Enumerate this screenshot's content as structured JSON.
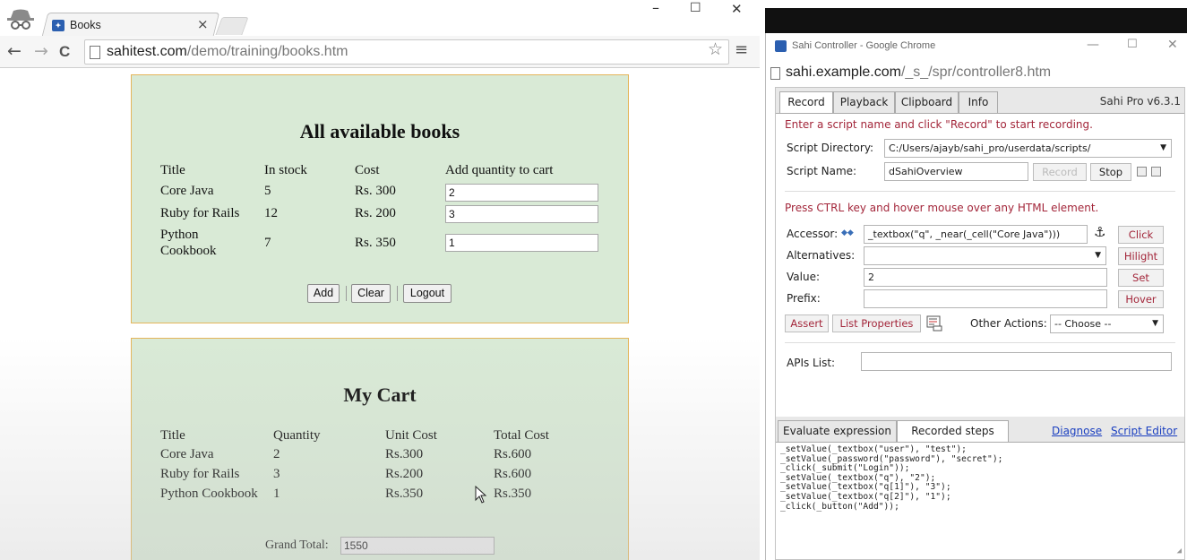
{
  "left_browser": {
    "tab": {
      "title": "Books",
      "close": "×"
    },
    "window_controls": {
      "minimize": "–",
      "maximize": "☐",
      "close": "✕"
    },
    "nav": {
      "back": "←",
      "forward": "→",
      "reload": "C"
    },
    "url": {
      "host": "sahitest.com",
      "path": "/demo/training/books.htm"
    },
    "star": "☆",
    "menu": "≡"
  },
  "books": {
    "title": "All available books",
    "headers": [
      "Title",
      "In stock",
      "Cost",
      "Add quantity to cart"
    ],
    "rows": [
      {
        "title": "Core Java",
        "stock": "5",
        "cost": "Rs. 300",
        "qty": "2"
      },
      {
        "title": "Ruby for Rails",
        "stock": "12",
        "cost": "Rs. 200",
        "qty": "3"
      },
      {
        "title_line1": "Python",
        "title_line2": "Cookbook",
        "stock": "7",
        "cost": "Rs. 350",
        "qty": "1"
      }
    ],
    "buttons": {
      "add": "Add",
      "clear": "Clear",
      "logout": "Logout"
    }
  },
  "cart": {
    "title": "My Cart",
    "headers": [
      "Title",
      "Quantity",
      "Unit Cost",
      "Total Cost"
    ],
    "rows": [
      {
        "title": "Core Java",
        "qty": "2",
        "unit": "Rs.300",
        "total": "Rs.600"
      },
      {
        "title": "Ruby for Rails",
        "qty": "3",
        "unit": "Rs.200",
        "total": "Rs.600"
      },
      {
        "title": "Python Cookbook",
        "qty": "1",
        "unit": "Rs.350",
        "total": "Rs.350"
      }
    ],
    "grand_total_label": "Grand Total:",
    "grand_total": "1550"
  },
  "controller": {
    "window_title": "Sahi Controller - Google Chrome",
    "window_controls": {
      "minimize": "—",
      "maximize": "☐",
      "close": "✕"
    },
    "url": {
      "host": "sahi.example.com",
      "path": "/_s_/spr/controller8.htm"
    },
    "tabs": [
      "Record",
      "Playback",
      "Clipboard",
      "Info"
    ],
    "version": "Sahi Pro v6.3.1",
    "record_hint": "Enter a script name and click \"Record\" to start recording.",
    "script_directory_label": "Script Directory:",
    "script_directory": "C:/Users/ajayb/sahi_pro/userdata/scripts/",
    "script_name_label": "Script Name:",
    "script_name": "dSahiOverview",
    "record_button": "Record",
    "stop_button": "Stop",
    "hover_hint": "Press CTRL key and hover mouse over any HTML element.",
    "accessor_label": "Accessor:",
    "accessor_glyph": "◆◆",
    "accessor": "_textbox(\"q\", _near(_cell(\"Core Java\")))",
    "anchor_glyph": "⚓",
    "alternatives_label": "Alternatives:",
    "value_label": "Value:",
    "value": "2",
    "prefix_label": "Prefix:",
    "buttons": {
      "click": "Click",
      "hilight": "Hilight",
      "set": "Set",
      "hover": "Hover",
      "assert": "Assert",
      "list_properties": "List Properties"
    },
    "other_actions_label": "Other Actions:",
    "other_actions": "-- Choose --",
    "apis_label": "APIs List:",
    "bottom_tabs": [
      "Evaluate expression",
      "Recorded steps"
    ],
    "links": [
      "Diagnose",
      "Script Editor"
    ],
    "recorded_steps": [
      "_setValue(_textbox(\"user\"), \"test\");",
      "_setValue(_password(\"password\"), \"secret\");",
      "_click(_submit(\"Login\"));",
      "_setValue(_textbox(\"q\"), \"2\");",
      "_setValue(_textbox(\"q[1]\"), \"3\");",
      "_setValue(_textbox(\"q[2]\"), \"1\");",
      "_click(_button(\"Add\"));"
    ]
  },
  "colors": {
    "panel_bg": "#d9ead6",
    "panel_border": "#e4b55a",
    "hint_red": "#a3263a",
    "link_blue": "#1a3fc0"
  }
}
